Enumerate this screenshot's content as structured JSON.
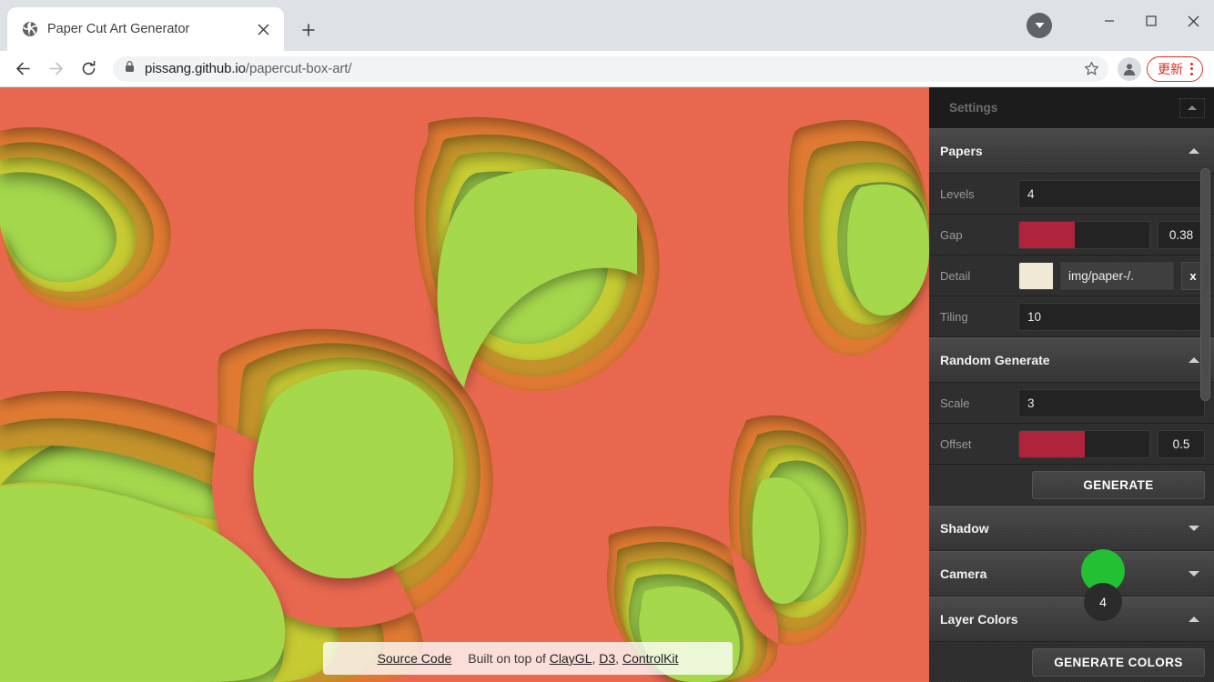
{
  "browser": {
    "tab": {
      "title": "Paper Cut Art Generator",
      "favicon": "globe-icon",
      "close": "close-icon"
    },
    "new_tab": "+",
    "window_controls": {
      "minimize": "minimize-icon",
      "maximize": "maximize-icon",
      "close": "close-icon"
    },
    "collapse_chip": "chevron-down-icon",
    "toolbar": {
      "back": "back-arrow-icon",
      "forward": "forward-arrow-icon",
      "reload": "reload-icon",
      "lock": "lock-icon",
      "url_domain": "pissang.github.io",
      "url_path": "/papercut-box-art/",
      "bookmark": "star-icon",
      "profile": "avatar-icon",
      "update_label": "更新",
      "menu": "kebab-menu-icon"
    }
  },
  "page": {
    "credit": {
      "source_code": "Source Code",
      "built_on": "Built on top of",
      "links": [
        "ClayGL",
        "D3",
        "ControlKit"
      ],
      "separator": ", "
    }
  },
  "settings": {
    "header": {
      "title": "Settings",
      "toggle": "collapse-icon"
    },
    "groups": [
      {
        "title": "Papers",
        "collapsed": false,
        "rows": [
          {
            "label": "Levels",
            "type": "number",
            "value": "4"
          },
          {
            "label": "Gap",
            "type": "slider",
            "value": "0.38",
            "fill_pct": 43,
            "fill_color": "#b0233c"
          },
          {
            "label": "Detail",
            "type": "texture",
            "value": "img/paper-/.",
            "swatch_color": "#efe9d5",
            "clear": "x"
          },
          {
            "label": "Tiling",
            "type": "number",
            "value": "10"
          }
        ]
      },
      {
        "title": "Random Generate",
        "collapsed": false,
        "rows": [
          {
            "label": "Scale",
            "type": "number",
            "value": "3"
          },
          {
            "label": "Offset",
            "type": "slider",
            "value": "0.5",
            "fill_pct": 50,
            "fill_color": "#b0233c"
          }
        ],
        "button": "GENERATE"
      },
      {
        "title": "Shadow",
        "collapsed": true,
        "rows": []
      },
      {
        "title": "Camera",
        "collapsed": true,
        "rows": []
      },
      {
        "title": "Layer Colors",
        "collapsed": false,
        "rows": [],
        "button": "GENERATE COLORS"
      }
    ]
  },
  "cursor": {
    "badge": "4",
    "color": "#22c032"
  },
  "artwork": {
    "palette": [
      "#a5d84c",
      "#c8cc33",
      "#c8922b",
      "#e07a30",
      "#e9684f",
      "#e2604c"
    ]
  }
}
